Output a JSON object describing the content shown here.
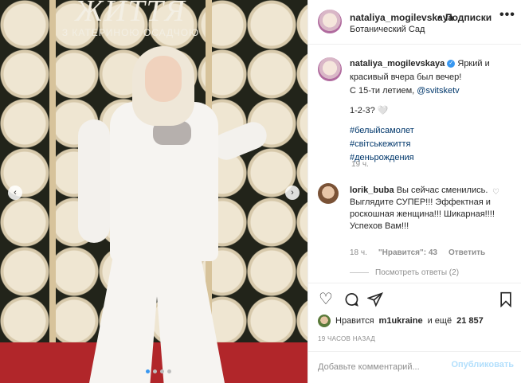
{
  "photo": {
    "sign_title": "ЖИТТЯ",
    "sign_subtitle": "З КАТЕРИНОЮ ОСАДЧОЮ",
    "prev_icon": "chevron-left-icon",
    "next_icon": "chevron-right-icon"
  },
  "header": {
    "username": "nataliya_mogilevskaya",
    "separator": "•",
    "follow_label": "Подписки",
    "location": "Ботанический Сад",
    "more_label": "•••"
  },
  "caption": {
    "username": "nataliya_mogilevskaya",
    "verified_icon": "verified-badge-icon",
    "line1": "Яркий и красивый вчера был вечер!",
    "line2_prefix": "С 15-ти летием, ",
    "mention": "@svitsketv",
    "line3": "1-2-3? 🤍",
    "tags": [
      "#белыйсамолет",
      "#світськежиття",
      "#деньрождения"
    ],
    "time": "19 ч."
  },
  "reply": {
    "username": "lorik_buba",
    "text": "Вы сейчас сменились. Выглядите СУПЕР!!! Эффектная и роскошная женщина!!! Шикарная!!!! Успехов Вам!!!",
    "time": "18 ч.",
    "likes": "\"Нравится\": 43",
    "reply_label": "Ответить",
    "view_replies": "Посмотреть ответы (2)",
    "heart_icon": "heart-outline-icon"
  },
  "actions": {
    "like_icon": "heart-outline-icon",
    "comment_icon": "comment-bubble-icon",
    "share_icon": "paper-plane-icon",
    "save_icon": "bookmark-icon"
  },
  "likes": {
    "prefix": "Нравится",
    "user": "m1ukraine",
    "suffix": "и ещё",
    "count": "21 857"
  },
  "ago": "19 ЧАСОВ НАЗАД",
  "comment_box": {
    "placeholder": "Добавьте комментарий...",
    "post_label": "Опубликовать"
  }
}
